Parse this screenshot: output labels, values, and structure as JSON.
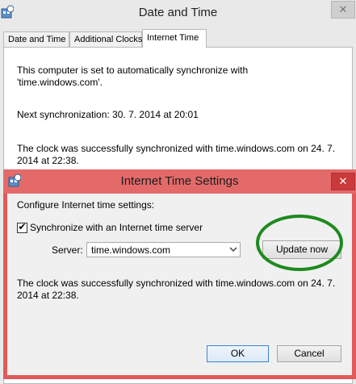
{
  "outer_window": {
    "title": "Date and Time",
    "close_glyph": "✕",
    "tabs": [
      {
        "label": "Date and Time",
        "active": false
      },
      {
        "label": "Additional Clocks",
        "active": false
      },
      {
        "label": "Internet Time",
        "active": true
      }
    ],
    "sync_info_line1": "This computer is set to automatically synchronize with",
    "sync_info_line2": "'time.windows.com'.",
    "next_sync": "Next synchronization: 30. 7. 2014 at 20:01",
    "last_sync_line1": "The clock was successfully synchronized with time.windows.com on 24. 7.",
    "last_sync_line2": "2014 at 22:38."
  },
  "dialog": {
    "title": "Internet Time Settings",
    "close_glyph": "✕",
    "configure_label": "Configure Internet time settings:",
    "sync_checkbox_label": "Synchronize with an Internet time server",
    "sync_checkbox_checked": true,
    "check_glyph": "✔",
    "server_label": "Server:",
    "server_value": "time.windows.com",
    "update_button": "Update now",
    "status_line1": "The clock was successfully synchronized with time.windows.com on 24. 7.",
    "status_line2": "2014 at 22:38.",
    "ok_button": "OK",
    "cancel_button": "Cancel"
  },
  "colors": {
    "dialog_frame": "#e05a5a",
    "annotation_circle": "#1e8a1e",
    "focus_border": "#3d85d3"
  },
  "icons": {
    "app": "date-time-icon",
    "dropdown": "chevron-down-icon",
    "close": "close-icon"
  }
}
